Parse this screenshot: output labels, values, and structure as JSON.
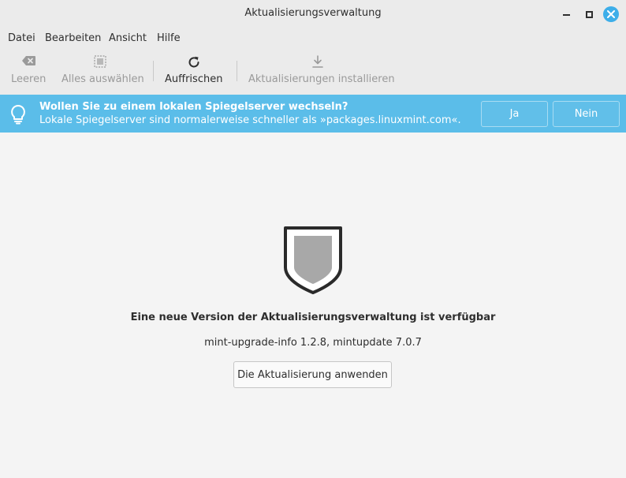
{
  "window": {
    "title": "Aktualisierungsverwaltung",
    "controls": {
      "minimize": "minimize-icon",
      "maximize": "maximize-icon",
      "close": "close-icon"
    }
  },
  "menubar": {
    "items": [
      {
        "label": "Datei"
      },
      {
        "label": "Bearbeiten"
      },
      {
        "label": "Ansicht"
      },
      {
        "label": "Hilfe"
      }
    ]
  },
  "toolbar": {
    "clear": {
      "label": "Leeren",
      "icon": "backspace-icon",
      "enabled": false
    },
    "select_all": {
      "label": "Alles auswählen",
      "icon": "select-all-icon",
      "enabled": false
    },
    "refresh": {
      "label": "Auffrischen",
      "icon": "refresh-icon",
      "enabled": true
    },
    "install": {
      "label": "Aktualisierungen installieren",
      "icon": "download-icon",
      "enabled": false
    }
  },
  "infobar": {
    "icon": "lightbulb-icon",
    "question": "Wollen Sie zu einem lokalen Spiegelserver wechseln?",
    "description": "Lokale Spiegelserver sind normalerweise schneller als »packages.linuxmint.com«.",
    "yes_label": "Ja",
    "no_label": "Nein",
    "color": "#5bbde9"
  },
  "main": {
    "icon": "shield-icon",
    "headline": "Eine neue Version der Aktualisierungsverwaltung ist verfügbar",
    "versions": "mint-upgrade-info 1.2.8, mintupdate 7.0.7",
    "apply_label": "Die Aktualisierung anwenden"
  },
  "colors": {
    "accent": "#3daee9",
    "infobar": "#5bbde9",
    "chrome": "#ebebeb",
    "background": "#f4f4f4"
  }
}
